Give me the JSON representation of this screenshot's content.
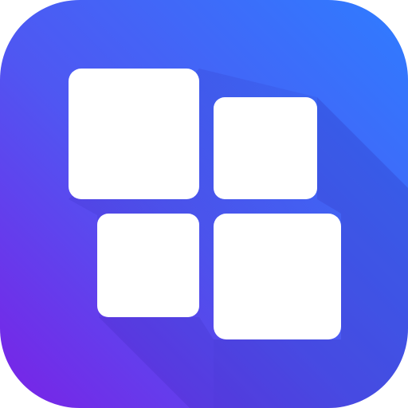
{
  "app_icon": {
    "icon_name": "four-tiles-grid-icon",
    "gradient": {
      "top_right": "#2f7cff",
      "middle": "#4f57f2",
      "bottom_left": "#7a22e6"
    },
    "shadow_color": "#2a1fa8",
    "tile_color": "#ffffff",
    "tile_count": 4
  }
}
